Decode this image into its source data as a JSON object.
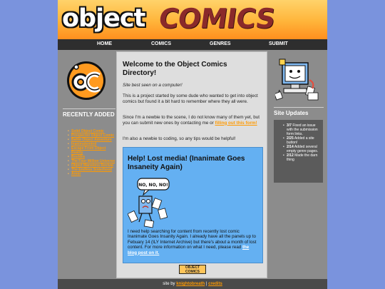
{
  "banner": {
    "word1": "object",
    "word2": "COMICS"
  },
  "nav": {
    "home": "HOME",
    "comics": "COMICS",
    "genres": "GENRES",
    "submit": "SUBMIT"
  },
  "left": {
    "badge_text": "oc",
    "recent_title": "RECENTLY ADDED",
    "recent_items": [
      "Solid Object Comic",
      "Prospector Object Comic",
      "Battle Object Adventure",
      "Inanimatemind",
      "Escape From Object Reality",
      "Bouldra",
      "The Four Million Universe",
      "Object Mansions Revival",
      "The Endless Sisterhood",
      "Armir"
    ]
  },
  "main": {
    "heading": "Welcome to the Object Comics Directory!",
    "note": "Site best seen on a computer!",
    "para1": "This is a project started by some dude who wanted to get into object comics but found it a bit hard to remember where they all were.",
    "para2_pre": "Since I'm a newbie to the scene, I do not know many of them yet, but you can submit new ones by contacting me or ",
    "para2_link": "filling out this form!",
    "para3": "I'm also a newbie to coding, so any tips would be helpful!",
    "lost": {
      "heading": "Help! Lost media! (Inanimate Goes Insaneity Again)",
      "speech": "NO, NO, NO!",
      "body_pre": "I need help searching for content from recently lost comic Inanimate Goes Insanity Again. I already have all the panels up to Febuary 14 (ILY Internet Archive) but there's about a month of lost content. For more information on what I need, please read ",
      "body_link": "the blog post on it."
    },
    "mini_logo": "OBJECT COMICS"
  },
  "right": {
    "updates_title": "Site Updates",
    "updates": [
      {
        "date": "3/7",
        "text": " Fixed an issue with the submission form links."
      },
      {
        "date": "2/25",
        "text": " Added a site button!"
      },
      {
        "date": "2/14",
        "text": " Added several empty genre pages."
      },
      {
        "date": "2/12",
        "text": " Made the darn thing"
      }
    ]
  },
  "footer": {
    "pre": "site by ",
    "author": "knightobreath",
    "sep": " | ",
    "credits": "credits"
  },
  "colors": {
    "background": "#7a93dd",
    "accent": "#ff9a00",
    "lost_box": "#64b0f2",
    "nav": "#2e2e2e"
  }
}
